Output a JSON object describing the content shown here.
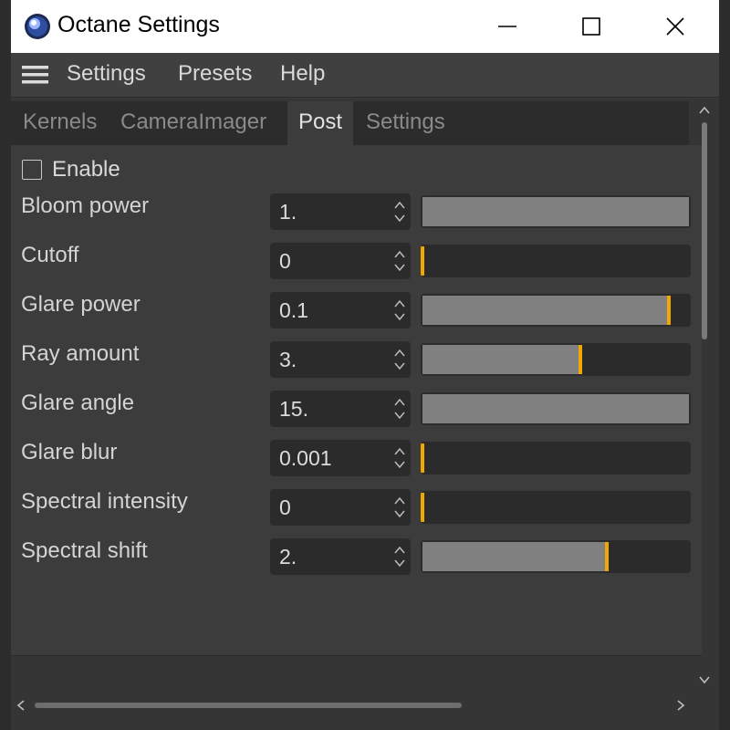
{
  "window": {
    "title": "Octane Settings"
  },
  "menubar": {
    "items": [
      "Settings",
      "Presets",
      "Help"
    ]
  },
  "tabs": [
    {
      "label": "Kernels",
      "active": false
    },
    {
      "label": "CameraImager",
      "active": false
    },
    {
      "label": "Post",
      "active": true
    },
    {
      "label": "Settings",
      "active": false
    }
  ],
  "enable": {
    "label": "Enable",
    "checked": false
  },
  "params": [
    {
      "label": "Bloom power",
      "value": "1.",
      "slider_fraction": 1.0,
      "marker": false
    },
    {
      "label": "Cutoff",
      "value": "0",
      "slider_fraction": 0.0,
      "marker": true
    },
    {
      "label": "Glare power",
      "value": "0.1",
      "slider_fraction": 0.93,
      "marker": true
    },
    {
      "label": "Ray amount",
      "value": "3.",
      "slider_fraction": 0.6,
      "marker": true
    },
    {
      "label": "Glare angle",
      "value": "15.",
      "slider_fraction": 1.0,
      "marker": false
    },
    {
      "label": "Glare blur",
      "value": "0.001",
      "slider_fraction": 0.0,
      "marker": true
    },
    {
      "label": "Spectral intensity",
      "value": "0",
      "slider_fraction": 0.0,
      "marker": true
    },
    {
      "label": "Spectral shift",
      "value": "2.",
      "slider_fraction": 0.7,
      "marker": true
    }
  ],
  "colors": {
    "accent": "#f0a800",
    "slider_fill": "#808080",
    "field_bg": "#2b2b2b",
    "panel_bg": "#3c3c3c"
  },
  "icons": {
    "app": "cinema4d-app-icon",
    "minimize": "minimize-icon",
    "maximize": "maximize-icon",
    "close": "close-icon",
    "menu": "hamburger-icon"
  }
}
